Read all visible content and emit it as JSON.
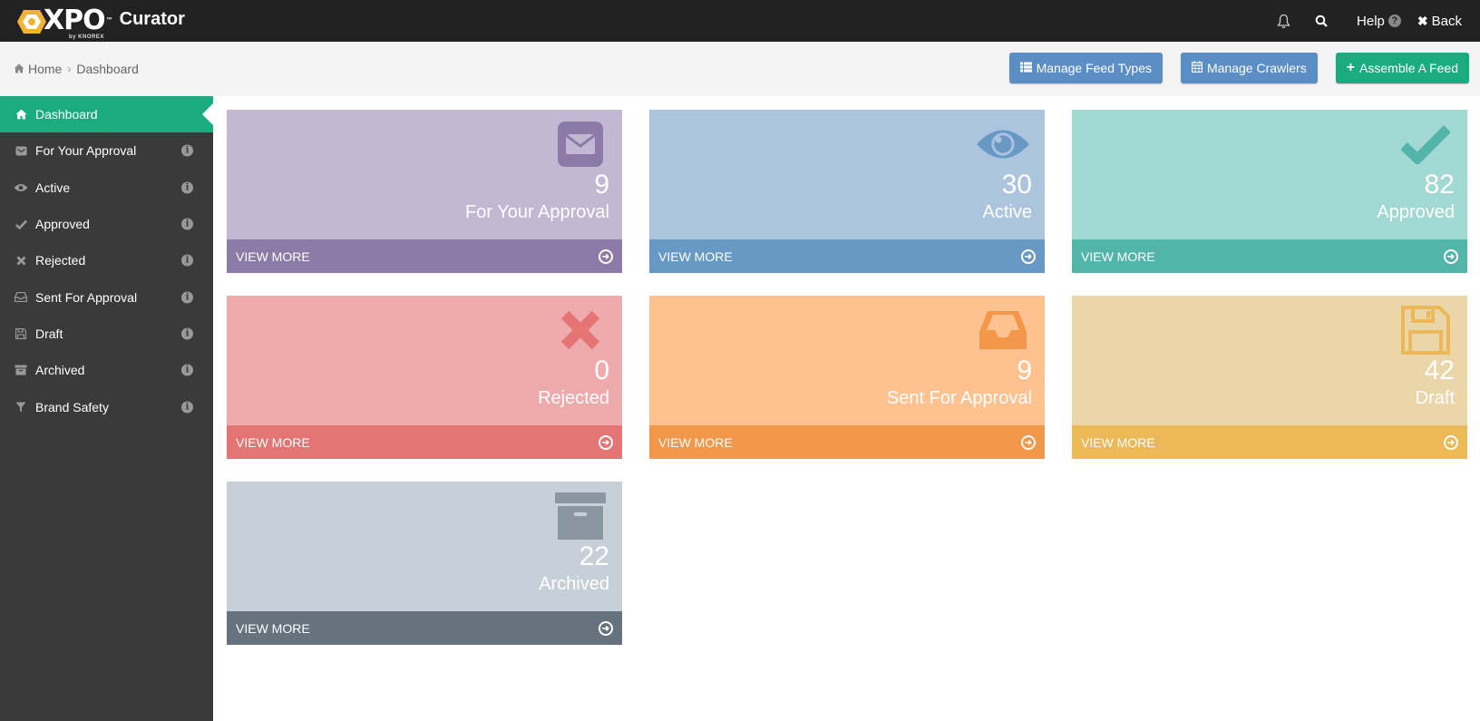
{
  "app": {
    "logo_text": "XPO",
    "logo_tm": "™",
    "logo_by": "by KNOREX",
    "product": "Curator"
  },
  "topbar": {
    "help_label": "Help",
    "back_label": "Back",
    "icons": [
      "bell-icon",
      "search-icon"
    ]
  },
  "breadcrumb": {
    "home": "Home",
    "current": "Dashboard"
  },
  "actions": {
    "manage_feed_types": "Manage Feed Types",
    "manage_crawlers": "Manage Crawlers",
    "assemble_feed": "Assemble A Feed"
  },
  "sidebar": {
    "items": [
      {
        "label": "Dashboard",
        "icon": "home-icon"
      },
      {
        "label": "For Your Approval",
        "icon": "envelope-icon"
      },
      {
        "label": "Active",
        "icon": "eye-icon"
      },
      {
        "label": "Approved",
        "icon": "check-icon"
      },
      {
        "label": "Rejected",
        "icon": "x-icon"
      },
      {
        "label": "Sent For Approval",
        "icon": "inbox-icon"
      },
      {
        "label": "Draft",
        "icon": "save-icon"
      },
      {
        "label": "Archived",
        "icon": "archive-icon"
      },
      {
        "label": "Brand Safety",
        "icon": "filter-icon"
      }
    ]
  },
  "cards": [
    {
      "count": "9",
      "label": "For Your Approval",
      "footer": "VIEW MORE",
      "icon": "envelope-icon",
      "bg": "#c3b8d4",
      "foot": "#8c7ba7",
      "icon_color": "#8c7ba7"
    },
    {
      "count": "30",
      "label": "Active",
      "footer": "VIEW MORE",
      "icon": "eye-icon",
      "bg": "#adc4df",
      "foot": "#6899c4",
      "icon_color": "#6899c4"
    },
    {
      "count": "82",
      "label": "Approved",
      "footer": "VIEW MORE",
      "icon": "check-icon",
      "bg": "#a2d9d3",
      "foot": "#53b4aa",
      "icon_color": "#53b4aa"
    },
    {
      "count": "0",
      "label": "Rejected",
      "footer": "VIEW MORE",
      "icon": "x-icon",
      "bg": "#efaaab",
      "foot": "#e57575",
      "icon_color": "#e57575"
    },
    {
      "count": "9",
      "label": "Sent For Approval",
      "footer": "VIEW MORE",
      "icon": "inbox-icon",
      "bg": "#fdc28f",
      "foot": "#f3974a",
      "icon_color": "#f3974a"
    },
    {
      "count": "42",
      "label": "Draft",
      "footer": "VIEW MORE",
      "icon": "save-icon",
      "bg": "#ead6a8",
      "foot": "#edb956",
      "icon_color": "#edb956"
    },
    {
      "count": "22",
      "label": "Archived",
      "footer": "VIEW MORE",
      "icon": "archive-icon",
      "bg": "#c7cfd8",
      "foot": "#66727d",
      "icon_color": "#8a97a3"
    }
  ]
}
